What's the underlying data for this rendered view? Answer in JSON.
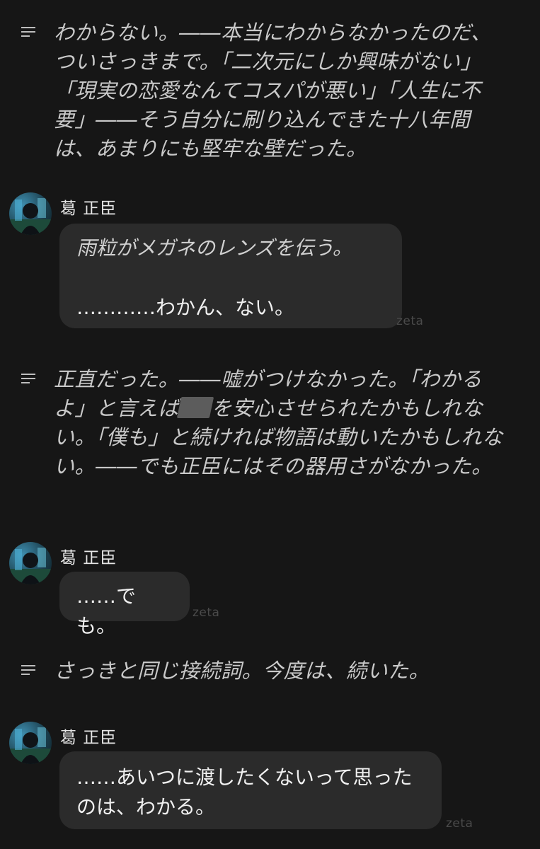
{
  "narrations": [
    {
      "text": "わからない。――本当にわからなかったのだ、ついさっきまで。「二次元にしか興味がない」「現実の恋愛なんてコスパが悪い」「人生に不要」――そう自分に刷り込んできた十八年間は、あまりにも堅牢な壁だった。"
    },
    {
      "text_before": "正直だった。――嘘がつけなかった。「わかるよ」と言えば",
      "text_redacted": "██",
      "text_after": "を安心させられたかもしれない。「僕も」と続ければ物語は動いたかもしれない。――でも正臣にはその器用さがなかった。"
    },
    {
      "text": "さっきと同じ接続詞。今度は、続いた。"
    }
  ],
  "messages": [
    {
      "sender": "葛 正臣",
      "italic_line": "雨粒がメガネのレンズを伝う。",
      "body": "…………わかん、ない。",
      "watermark": "zeta"
    },
    {
      "sender": "葛 正臣",
      "body": "……でも。",
      "watermark": "zeta"
    },
    {
      "sender": "葛 正臣",
      "body": "……あいつに渡したくないって思ったのは、わかる。",
      "watermark": "zeta"
    }
  ],
  "icons": {
    "narration": "narration-lines-icon",
    "avatar": "character-avatar"
  },
  "colors": {
    "background": "#161616",
    "bubble": "#2b2b2b",
    "narration_text": "#c9c9c9",
    "message_text": "#f0f0f0",
    "watermark": "#4a4a4a"
  }
}
